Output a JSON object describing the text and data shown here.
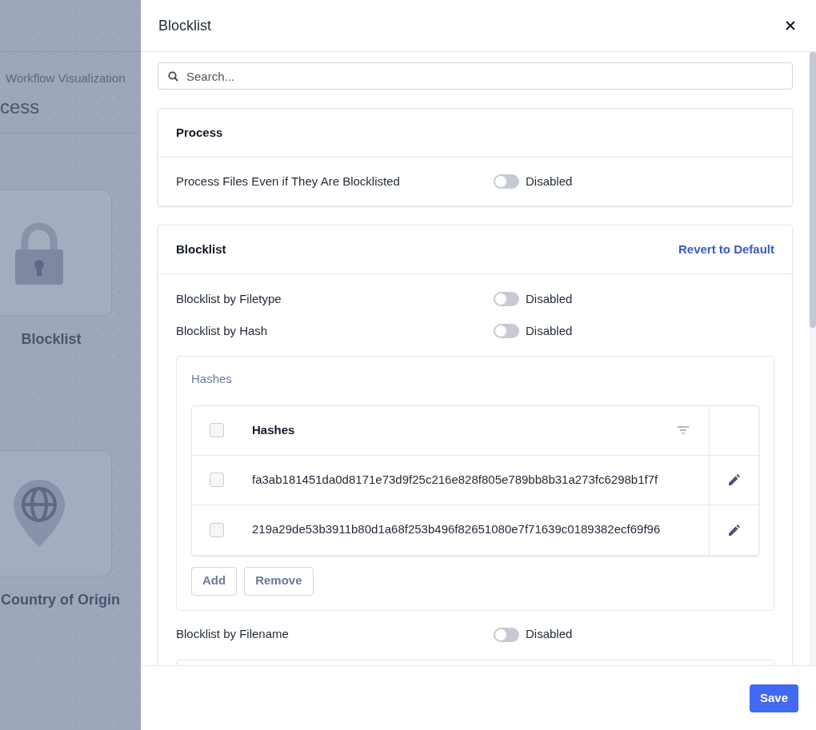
{
  "background": {
    "breadcrumb": "Workflow Visualization",
    "title": "cess",
    "nodes": [
      {
        "kind": "lock",
        "label": "Blocklist"
      },
      {
        "kind": "globe",
        "label": "Country of Origin"
      }
    ]
  },
  "drawer": {
    "title": "Blocklist",
    "search": {
      "placeholder": "Search..."
    },
    "sections": [
      {
        "title": "Process",
        "items": [
          {
            "kind": "toggle",
            "label": "Process Files Even if They Are Blocklisted",
            "on": false,
            "state": "Disabled"
          }
        ]
      },
      {
        "title": "Blocklist",
        "action": "Revert to Default",
        "items": [
          {
            "kind": "toggle",
            "label": "Blocklist by Filetype",
            "on": false,
            "state": "Disabled"
          },
          {
            "kind": "toggle",
            "label": "Blocklist by Hash",
            "on": false,
            "state": "Disabled"
          },
          {
            "kind": "table",
            "title": "Hashes",
            "column": "Hashes",
            "all_checked": false,
            "rows": [
              {
                "value": "fa3ab181451da0d8171e73d9f25c216e828f805e789bb8b31a273fc6298b1f7f",
                "checked": false
              },
              {
                "value": "219a29de53b3911b80d1a68f253b496f82651080e7f71639c0189382ecf69f96",
                "checked": false
              }
            ],
            "buttons": [
              "Add",
              "Remove"
            ]
          },
          {
            "kind": "toggle",
            "label": "Blocklist by Filename",
            "on": false,
            "state": "Disabled"
          },
          {
            "kind": "empty"
          }
        ]
      }
    ]
  },
  "footer": {
    "save": "Save"
  }
}
